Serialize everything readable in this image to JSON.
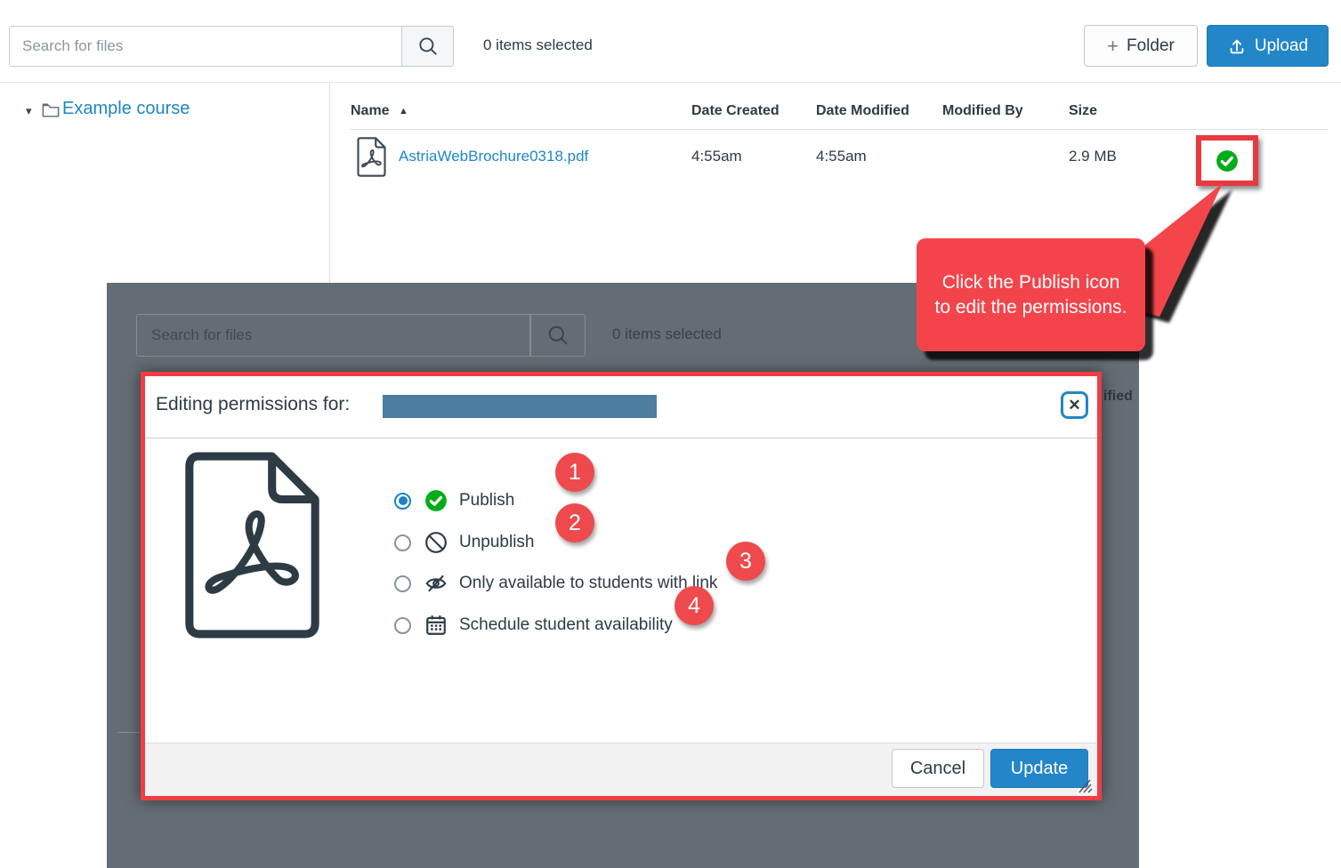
{
  "icons": {
    "plus": "+",
    "caret_down": "▾",
    "sort_asc": "▲",
    "close": "✕"
  },
  "toolbar": {
    "search_placeholder": "Search for files",
    "items_selected": "0 items selected",
    "folder_label": "Folder",
    "upload_label": "Upload"
  },
  "sidebar": {
    "course_name": "Example course"
  },
  "files_table": {
    "columns": [
      "Name",
      "Date Created",
      "Date Modified",
      "Modified By",
      "Size"
    ],
    "rows": [
      {
        "name": "AstriaWebBrochure0318.pdf",
        "date_created": "4:55am",
        "date_modified": "4:55am",
        "modified_by": "",
        "size": "2.9 MB",
        "status": "published"
      }
    ]
  },
  "annotation": {
    "callout_text": "Click the Publish icon to edit the permissions."
  },
  "dimmed_background": {
    "search_placeholder": "Search for files",
    "items_selected": "0 items selected",
    "header_fragment": "ified"
  },
  "modal": {
    "title": "Editing permissions for:",
    "options": [
      {
        "number": "1",
        "label": "Publish",
        "selected": true
      },
      {
        "number": "2",
        "label": "Unpublish",
        "selected": false
      },
      {
        "number": "3",
        "label": "Only available to students with link",
        "selected": false
      },
      {
        "number": "4",
        "label": "Schedule student availability",
        "selected": false
      }
    ],
    "cancel_label": "Cancel",
    "update_label": "Update"
  },
  "colors": {
    "accent_blue": "#2386c8",
    "link_blue": "#1d87c8",
    "published_green": "#00ac18",
    "annotation_red": "#ee3e44",
    "callout_red": "#f4444b",
    "overlay_gray": "#646d75",
    "redaction_blue": "#4e7da2",
    "text_dark": "#2d3b45"
  }
}
